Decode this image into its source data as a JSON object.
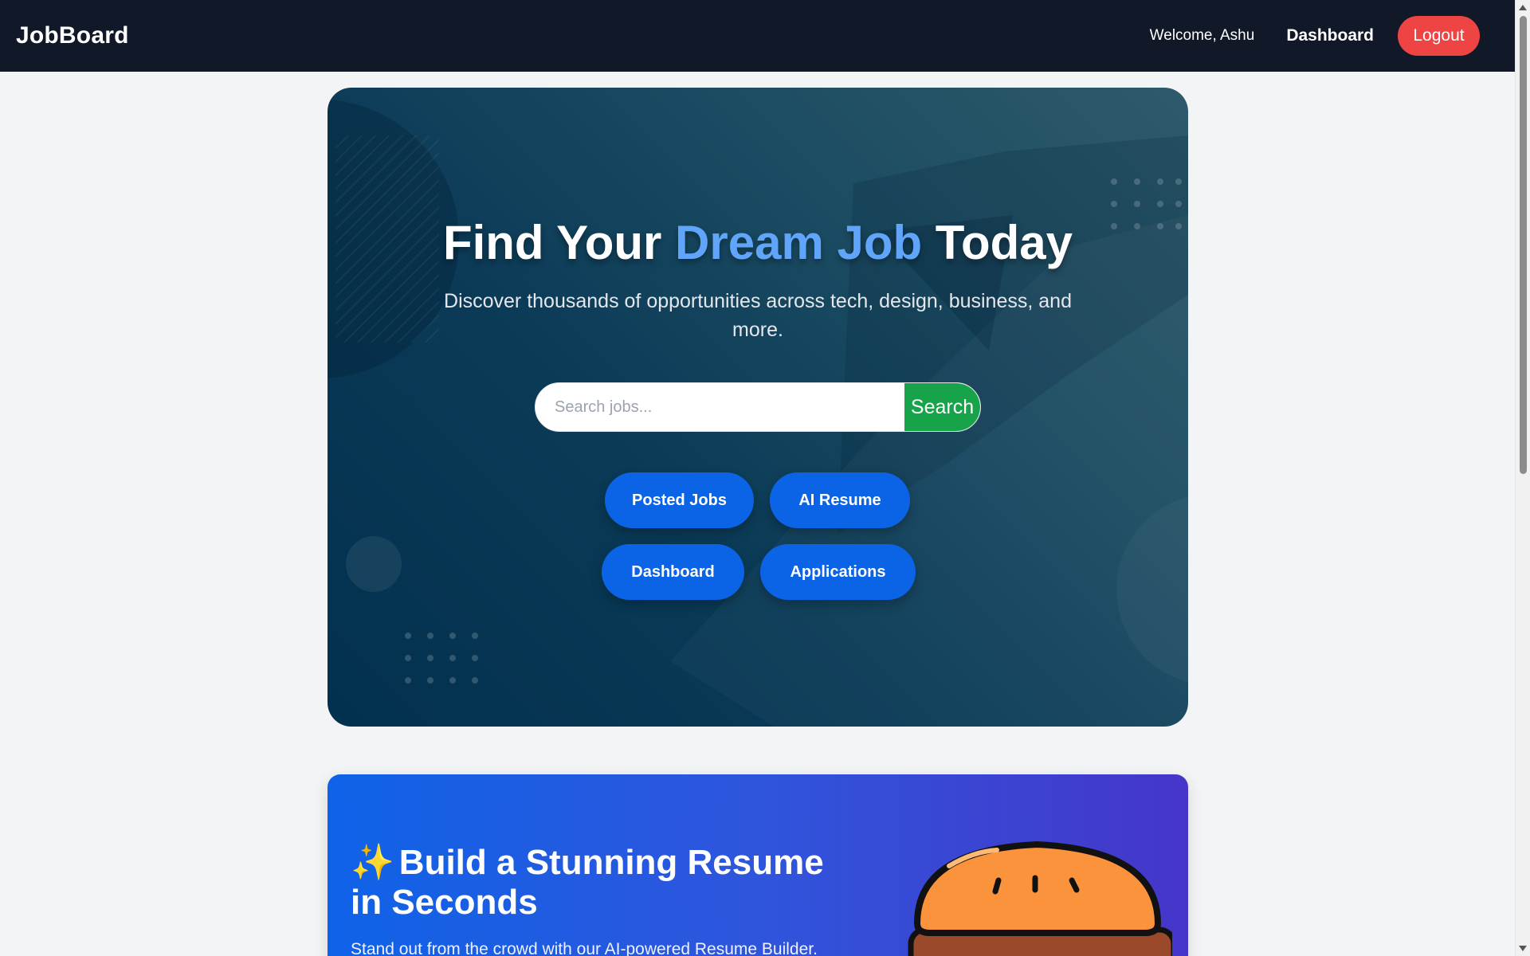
{
  "navbar": {
    "brand": "JobBoard",
    "welcome": "Welcome, Ashu",
    "dashboard_label": "Dashboard",
    "logout_label": "Logout"
  },
  "hero": {
    "title_part1": "Find Your ",
    "title_accent": "Dream Job",
    "title_part2": " Today",
    "subtitle": "Discover thousands of opportunities across tech, design, business, and more.",
    "search": {
      "placeholder": "Search jobs...",
      "value": "",
      "button_label": "Search"
    },
    "actions": [
      {
        "label": "Posted Jobs"
      },
      {
        "label": "AI Resume"
      },
      {
        "label": "Dashboard"
      },
      {
        "label": "Applications"
      }
    ]
  },
  "resume_banner": {
    "icon": "sparkles-icon",
    "sparkle": "✨",
    "title": "Build a Stunning Resume in Seconds",
    "text": "Stand out from the crowd with our AI-powered Resume Builder.",
    "illustration": "burger-illustration"
  },
  "colors": {
    "navbar_bg": "#111827",
    "logout_red": "#ef4444",
    "accent_blue": "#60a5fa",
    "search_green": "#16a34a",
    "pill_blue": "#0b63e5"
  }
}
